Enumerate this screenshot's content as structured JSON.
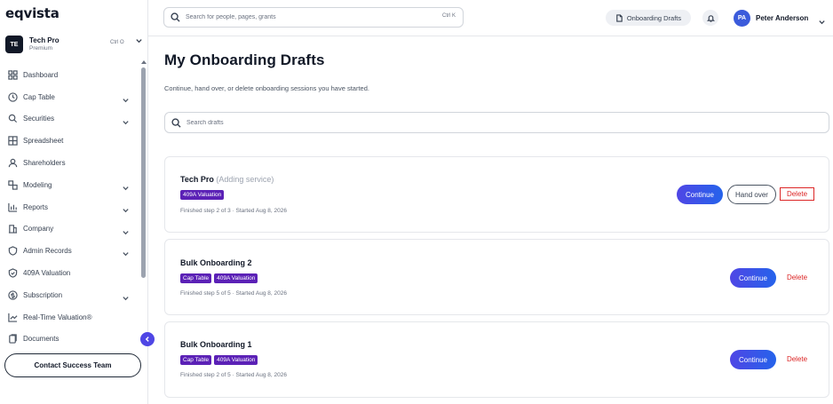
{
  "app": {
    "logo": "eqvista"
  },
  "org": {
    "initials": "TE",
    "name": "Tech Pro",
    "plan": "Premium",
    "shortcut": "Ctrl O"
  },
  "sidebar": {
    "items": [
      {
        "label": "Dashboard",
        "icon": "dashboard-icon",
        "has_chevron": false
      },
      {
        "label": "Cap Table",
        "icon": "cap-table-icon",
        "has_chevron": true
      },
      {
        "label": "Securities",
        "icon": "securities-icon",
        "has_chevron": true
      },
      {
        "label": "Spreadsheet",
        "icon": "spreadsheet-icon",
        "has_chevron": false
      },
      {
        "label": "Shareholders",
        "icon": "shareholders-icon",
        "has_chevron": false
      },
      {
        "label": "Modeling",
        "icon": "modeling-icon",
        "has_chevron": true
      },
      {
        "label": "Reports",
        "icon": "reports-icon",
        "has_chevron": true
      },
      {
        "label": "Company",
        "icon": "company-icon",
        "has_chevron": true
      },
      {
        "label": "Admin Records",
        "icon": "admin-records-icon",
        "has_chevron": true
      },
      {
        "label": "409A Valuation",
        "icon": "valuation-icon",
        "has_chevron": false
      },
      {
        "label": "Subscription",
        "icon": "subscription-icon",
        "has_chevron": true
      },
      {
        "label": "Real-Time Valuation®",
        "icon": "chart-line-icon",
        "has_chevron": false
      },
      {
        "label": "Documents",
        "icon": "documents-icon",
        "has_chevron": false
      }
    ],
    "contact_label": "Contact Success Team"
  },
  "topbar": {
    "search_placeholder": "Search for people, pages, grants",
    "search_shortcut": "Ctrl K",
    "drafts_label": "Onboarding Drafts",
    "user_initials": "PA",
    "user_name": "Peter Anderson"
  },
  "main": {
    "title": "My Onboarding Drafts",
    "subtitle": "Continue, hand over, or delete onboarding sessions you have started.",
    "search_placeholder": "Search drafts",
    "drafts": [
      {
        "name": "Tech Pro",
        "context": "(Adding service)",
        "tags": [
          "409A Valuation"
        ],
        "meta": "Finished step 2 of 3 · Started Aug 8, 2026",
        "continue_label": "Continue",
        "handover_label": "Hand over",
        "delete_label": "Delete"
      },
      {
        "name": "Bulk Onboarding 2",
        "context": "",
        "tags": [
          "Cap Table",
          "409A Valuation"
        ],
        "meta": "Finished step 5 of 5 · Started Aug 8, 2026",
        "continue_label": "Continue",
        "delete_label": "Delete"
      },
      {
        "name": "Bulk Onboarding 1",
        "context": "",
        "tags": [
          "Cap Table",
          "409A Valuation"
        ],
        "meta": "Finished step 2 of 5 · Started Aug 8, 2026",
        "continue_label": "Continue",
        "delete_label": "Delete"
      }
    ]
  },
  "colors": {
    "accent": "#4f46e5",
    "tag": "#5b21b6",
    "delete": "#dc2626"
  }
}
